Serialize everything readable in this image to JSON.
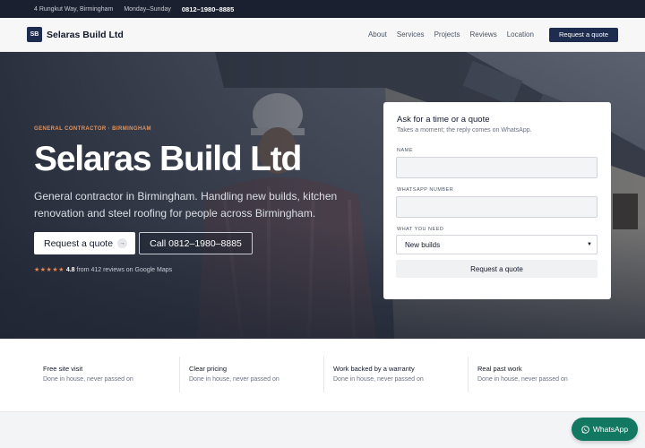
{
  "topbar": {
    "address": "4 Rungkut Way, Birmingham",
    "hours": "Monday–Sunday",
    "phone": "0812–1980–8885"
  },
  "nav": {
    "logo_mark": "SB",
    "brand": "Selaras Build Ltd",
    "links": [
      "About",
      "Services",
      "Projects",
      "Reviews",
      "Location"
    ],
    "cta": "Request a quote"
  },
  "hero": {
    "eyebrow": "GENERAL CONTRACTOR · BIRMINGHAM",
    "title": "Selaras Build Ltd",
    "subtitle": "General contractor in Birmingham. Handling new builds, kitchen renovation and steel roofing for people across Birmingham.",
    "primary_button": "Request a quote",
    "primary_button_icon": "arrow-right-icon",
    "secondary_button": "Call 0812–1980–8885",
    "rating": {
      "stars": "★★★★★",
      "score": "4.8",
      "text": "from 412 reviews on Google Maps"
    }
  },
  "form": {
    "title": "Ask for a time or a quote",
    "description": "Takes a moment; the reply comes on WhatsApp.",
    "name_label": "NAME",
    "whatsapp_label": "WHATSAPP NUMBER",
    "need_label": "WHAT YOU NEED",
    "need_selected": "New builds",
    "submit": "Request a quote"
  },
  "features": [
    {
      "title": "Free site visit",
      "desc": "Done in house, never passed on"
    },
    {
      "title": "Clear pricing",
      "desc": "Done in house, never passed on"
    },
    {
      "title": "Work backed by a warranty",
      "desc": "Done in house, never passed on"
    },
    {
      "title": "Real past work",
      "desc": "Done in house, never passed on"
    }
  ],
  "whatsapp": {
    "label": "WhatsApp",
    "color": "#127862"
  },
  "colors": {
    "brand_navy": "#1e2d4f",
    "accent_orange": "#e29460",
    "topbar": "#1b2030"
  }
}
